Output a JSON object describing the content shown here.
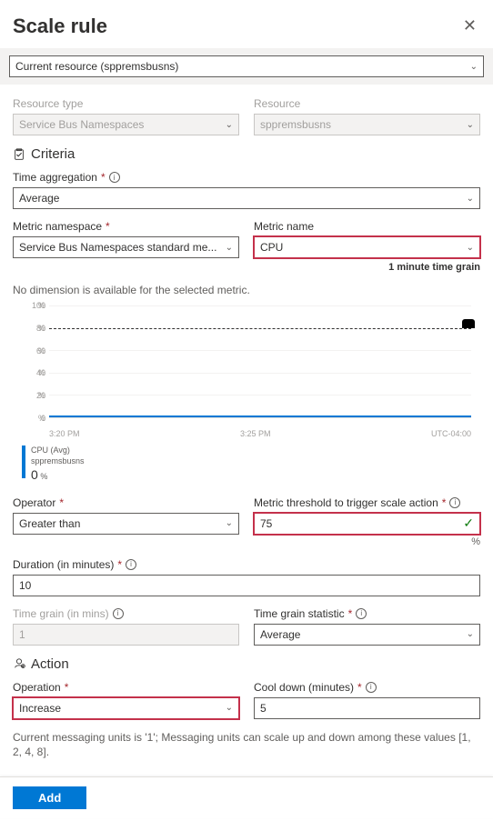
{
  "header": {
    "title": "Scale rule"
  },
  "resource_selector": {
    "value": "Current resource (sppremsbusns)"
  },
  "resource_type": {
    "label": "Resource type",
    "value": "Service Bus Namespaces"
  },
  "resource": {
    "label": "Resource",
    "value": "sppremsbusns"
  },
  "criteria": {
    "title": "Criteria",
    "time_aggregation": {
      "label": "Time aggregation",
      "value": "Average"
    },
    "metric_namespace": {
      "label": "Metric namespace",
      "value": "Service Bus Namespaces standard me..."
    },
    "metric_name": {
      "label": "Metric name",
      "value": "CPU"
    },
    "time_grain_note": "1 minute time grain",
    "no_dimension": "No dimension is available for the selected metric.",
    "operator": {
      "label": "Operator",
      "value": "Greater than"
    },
    "threshold": {
      "label": "Metric threshold to trigger scale action",
      "value": "75",
      "unit": "%"
    },
    "duration": {
      "label": "Duration (in minutes)",
      "value": "10"
    },
    "time_grain_mins": {
      "label": "Time grain (in mins)",
      "value": "1"
    },
    "time_grain_stat": {
      "label": "Time grain statistic",
      "value": "Average"
    }
  },
  "action": {
    "title": "Action",
    "operation": {
      "label": "Operation",
      "value": "Increase"
    },
    "cooldown": {
      "label": "Cool down (minutes)",
      "value": "5"
    },
    "note": "Current messaging units is '1'; Messaging units can scale up and down among these values [1, 2, 4, 8]."
  },
  "buttons": {
    "add": "Add"
  },
  "chart_data": {
    "type": "line",
    "title": "",
    "xlabel": "",
    "ylabel": "",
    "ylim": [
      0,
      100
    ],
    "yticks": [
      0,
      20,
      40,
      60,
      80,
      100
    ],
    "xticks": [
      "3:20 PM",
      "3:25 PM",
      "UTC-04:00"
    ],
    "threshold_line": 80,
    "series": [
      {
        "name": "CPU (Avg)",
        "resource": "sppremsbusns",
        "current_value": 0,
        "unit": "%",
        "values": [
          0,
          0,
          0,
          0,
          0,
          0,
          0,
          0,
          0,
          0
        ]
      }
    ]
  }
}
